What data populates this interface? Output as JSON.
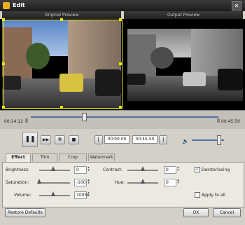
{
  "window": {
    "title": "Edit"
  },
  "panels": {
    "original_label": "Original Preview",
    "output_label": "Output Preview"
  },
  "timeline": {
    "current_time": "00:14:12",
    "end_time": "00:45:50",
    "position": 0.28
  },
  "trim": {
    "start_value": "00:00:00",
    "end_value": "00:45:50"
  },
  "volume": {
    "level": 0.83
  },
  "tabs": [
    {
      "label": "Effect",
      "active": true
    },
    {
      "label": "Trim",
      "active": false
    },
    {
      "label": "Crop",
      "active": false
    },
    {
      "label": "Watermark",
      "active": false
    }
  ],
  "effect": {
    "brightness_label": "Brightness:",
    "brightness_value": "0",
    "contrast_label": "Contrast:",
    "contrast_value": "0",
    "saturation_label": "Saturation:",
    "saturation_value": "-100",
    "hue_label": "Hue:",
    "hue_value": "0",
    "volume_label": "Volume:",
    "volume_value": "100%",
    "deinterlacing_label": "Deinterlacing",
    "deinterlacing_checked": true,
    "apply_all_label": "Apply to all",
    "apply_all_checked": false
  },
  "buttons": {
    "restore_defaults": "Restore Defaults",
    "ok": "OK",
    "cancel": "Cancel"
  },
  "colors": {
    "accent": "#5570a8",
    "crop_frame": "#e8e800",
    "title_bar": "#2a2a2a"
  },
  "icons": {
    "close": "close-icon",
    "play_pause": "pause-icon",
    "next": "fast-forward-icon",
    "snapshot": "snapshot-icon",
    "stop": "stop-icon",
    "trim_start": "left-bracket-icon",
    "trim_end": "right-bracket-icon",
    "volume": "speaker-icon"
  }
}
